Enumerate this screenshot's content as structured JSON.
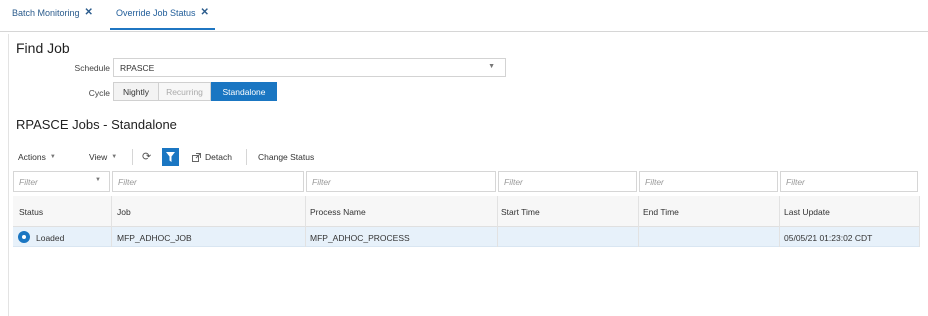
{
  "tabs": [
    {
      "label": "Batch Monitoring",
      "close": "✕"
    },
    {
      "label": "Override Job Status",
      "close": "✕"
    }
  ],
  "find_job": {
    "title": "Find Job",
    "schedule_label": "Schedule",
    "schedule_value": "RPASCE",
    "cycle_label": "Cycle",
    "cycle_options": [
      "Nightly",
      "Recurring",
      "Standalone"
    ],
    "cycle_selected": "Standalone"
  },
  "jobs": {
    "title": "RPASCE Jobs - Standalone",
    "toolbar": {
      "actions": "Actions",
      "view": "View",
      "detach": "Detach",
      "change_status": "Change Status"
    },
    "filter_placeholder": "Filter",
    "columns": [
      "Status",
      "Job",
      "Process Name",
      "Start Time",
      "End Time",
      "Last Update"
    ],
    "rows": [
      {
        "status": "Loaded",
        "job": "MFP_ADHOC_JOB",
        "process_name": "MFP_ADHOC_PROCESS",
        "start_time": "",
        "end_time": "",
        "last_update": "05/05/21 01:23:02 CDT"
      }
    ]
  },
  "colors": {
    "accent": "#1a76c2",
    "selected_row": "#e7f1fa",
    "tab_text": "#2a5b8c"
  },
  "icons": [
    "close-icon",
    "chevron-down-icon",
    "refresh-icon",
    "filter-icon",
    "detach-icon",
    "radio-selected-icon"
  ]
}
